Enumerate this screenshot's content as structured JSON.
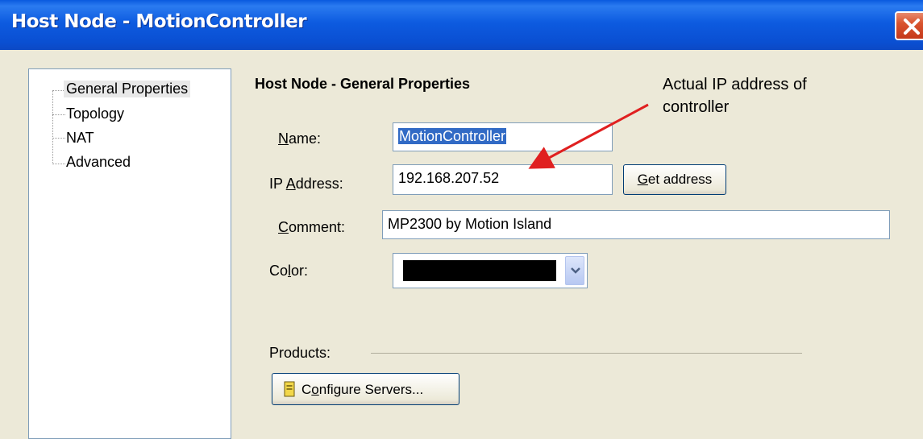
{
  "window": {
    "title": "Host Node - MotionController"
  },
  "tree": {
    "items": [
      {
        "label": "General Properties",
        "selected": true
      },
      {
        "label": "Topology",
        "selected": false
      },
      {
        "label": "NAT",
        "selected": false
      },
      {
        "label": "Advanced",
        "selected": false
      }
    ]
  },
  "panel": {
    "title": "Host Node - General Properties",
    "name": {
      "label_accel": "N",
      "label_rest": "ame:",
      "value": "MotionController"
    },
    "ip": {
      "label_pre": "IP ",
      "label_accel": "A",
      "label_rest": "ddress:",
      "value": "192.168.207.52"
    },
    "get_address": {
      "accel": "G",
      "rest": "et address"
    },
    "comment": {
      "label_accel": "C",
      "label_rest": "omment:",
      "value": "MP2300 by Motion Island"
    },
    "color": {
      "label_pre": "Co",
      "label_accel": "l",
      "label_rest": "or:",
      "value": "#000000"
    },
    "products": {
      "label": "Products:"
    },
    "configure": {
      "pre": "C",
      "accel": "o",
      "rest": "nfigure Servers..."
    }
  },
  "annotation": {
    "text_line1": "Actual IP address of",
    "text_line2": "controller"
  },
  "colors": {
    "title_blue": "#0a5adf",
    "selection": "#316ac5",
    "arrow": "#e02020"
  }
}
